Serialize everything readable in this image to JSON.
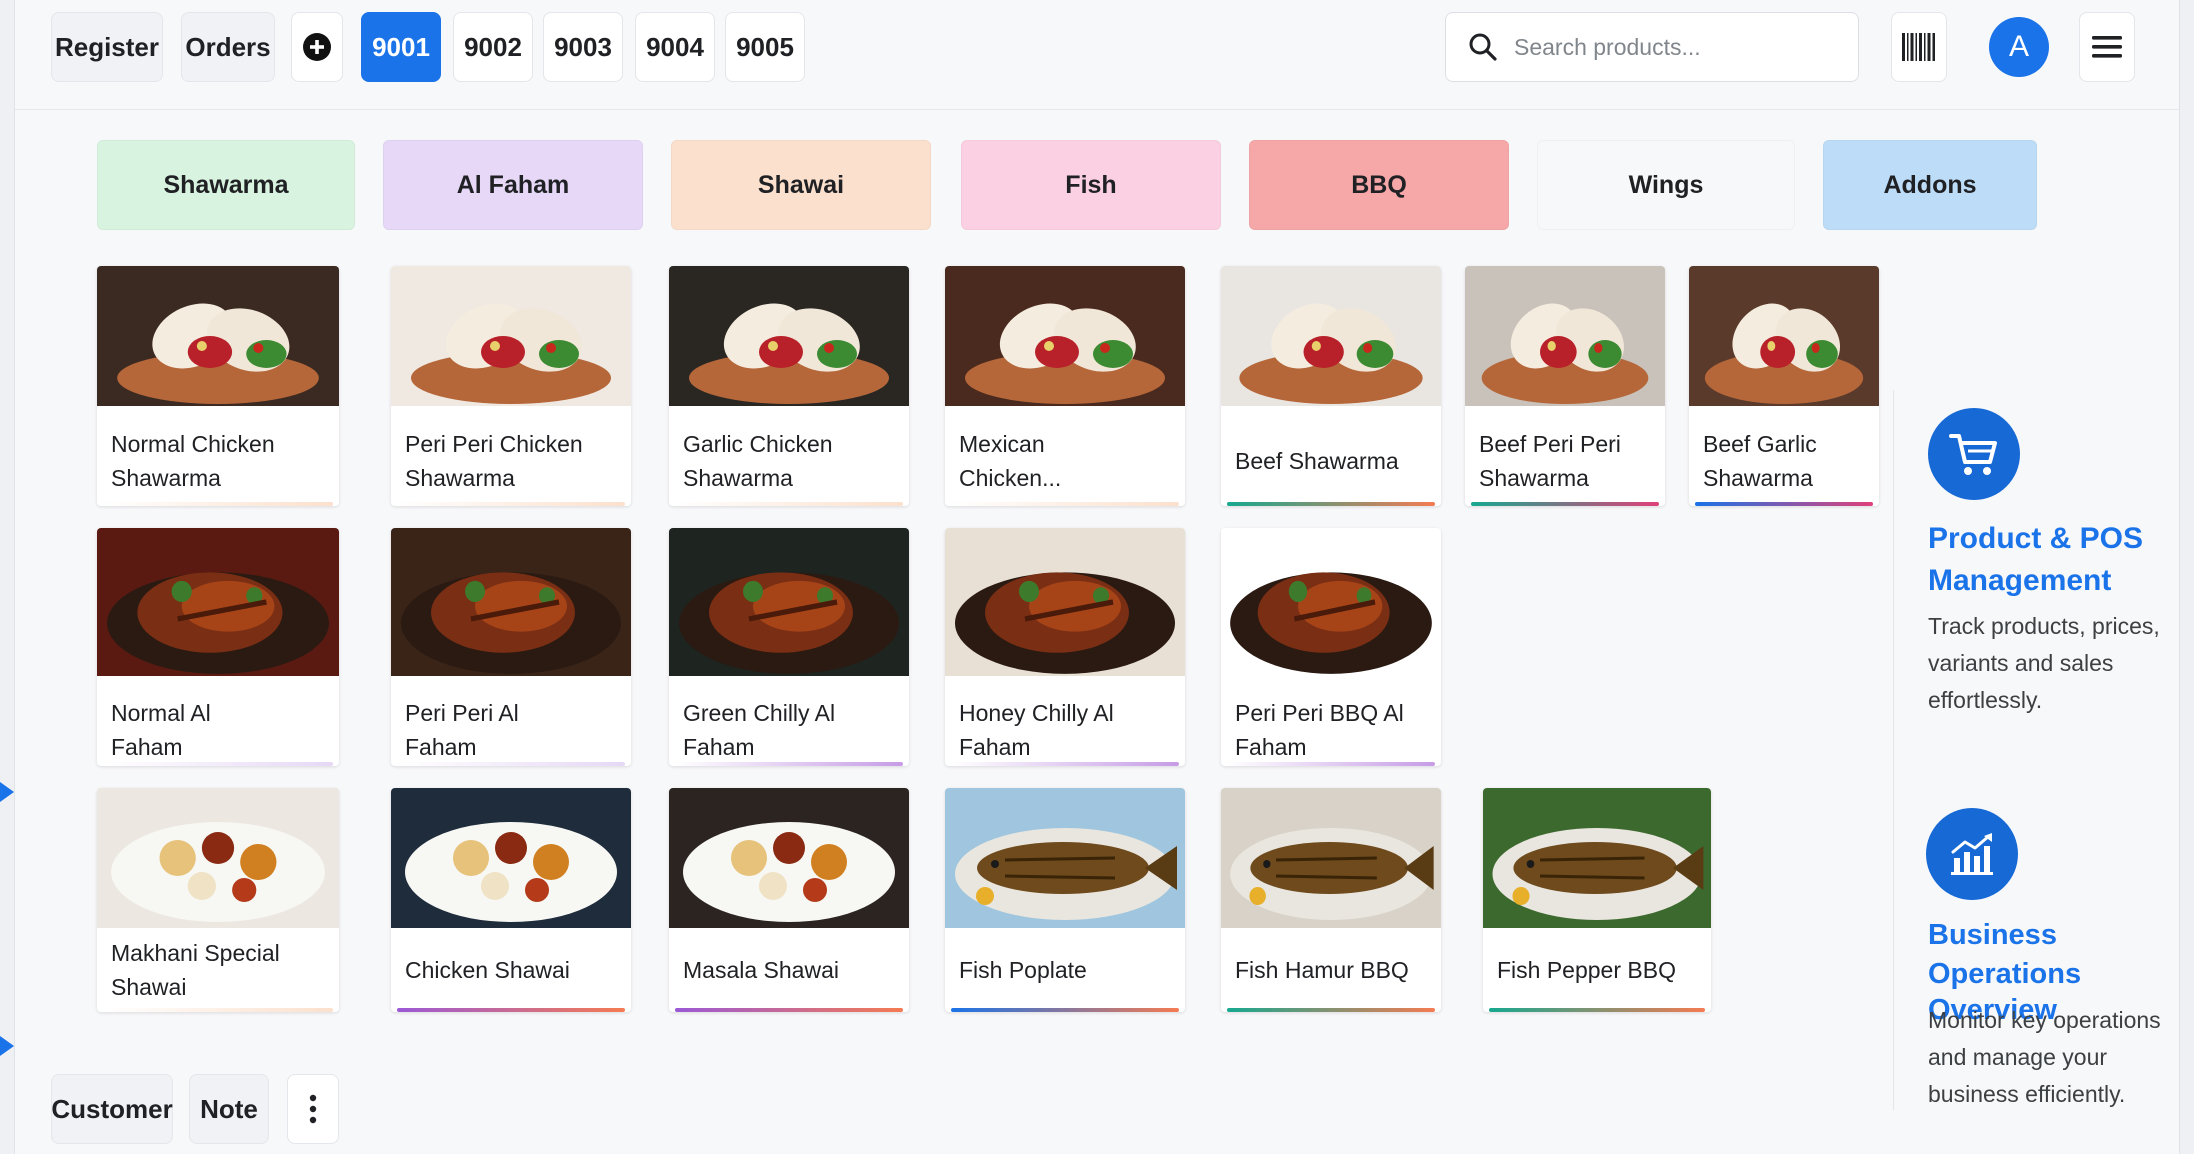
{
  "topbar": {
    "register": "Register",
    "orders": "Orders",
    "order_tabs": [
      "9001",
      "9002",
      "9003",
      "9004",
      "9005"
    ],
    "active_tab": "9001",
    "search_placeholder": "Search products...",
    "avatar_letter": "A"
  },
  "categories": [
    {
      "label": "Shawarma",
      "color": "#d8f3df"
    },
    {
      "label": "Al Faham",
      "color": "#e6d8f6"
    },
    {
      "label": "Shawai",
      "color": "#fbe0cd"
    },
    {
      "label": "Fish",
      "color": "#fbd0e3"
    },
    {
      "label": "BBQ",
      "color": "#f6a8a8"
    },
    {
      "label": "Wings",
      "color": "#f7f8fa"
    },
    {
      "label": "Addons",
      "color": "#bcdcf7"
    }
  ],
  "products": [
    [
      "Normal Chicken",
      "Shawarma"
    ],
    [
      "Peri Peri Chicken",
      "Shawarma"
    ],
    [
      "Garlic Chicken",
      "Shawarma"
    ],
    [
      "Mexican",
      "Chicken..."
    ],
    [
      "Beef Shawarma"
    ],
    [
      "Beef Peri Peri",
      "Shawarma"
    ],
    [
      "Beef Garlic",
      "Shawarma"
    ],
    [
      "Normal Al",
      "Faham"
    ],
    [
      "Peri Peri Al",
      "Faham"
    ],
    [
      "Green Chilly Al",
      "Faham"
    ],
    [
      "Honey Chilly Al",
      "Faham"
    ],
    [
      "Peri Peri BBQ Al",
      "Faham"
    ],
    [
      "Makhani Special",
      "Shawai"
    ],
    [
      "Chicken Shawai"
    ],
    [
      "Masala Shawai"
    ],
    [
      "Fish Poplate"
    ],
    [
      "Fish Hamur BBQ"
    ],
    [
      "Fish Pepper BBQ"
    ]
  ],
  "bottombar": {
    "customer": "Customer",
    "note": "Note"
  },
  "features": [
    {
      "icon": "cart-icon",
      "title": [
        "Product & POS",
        "Management"
      ],
      "desc": [
        "Track products, prices,",
        "variants and sales",
        "effortlessly."
      ]
    },
    {
      "icon": "chart-icon",
      "title": [
        "Business",
        "Operations Overview"
      ],
      "desc": [
        "Monitor key operations",
        "and manage your",
        "business efficiently."
      ]
    }
  ],
  "colors": {
    "accent": "#1a73e8",
    "feature_icon_bg": "#1769d6"
  }
}
